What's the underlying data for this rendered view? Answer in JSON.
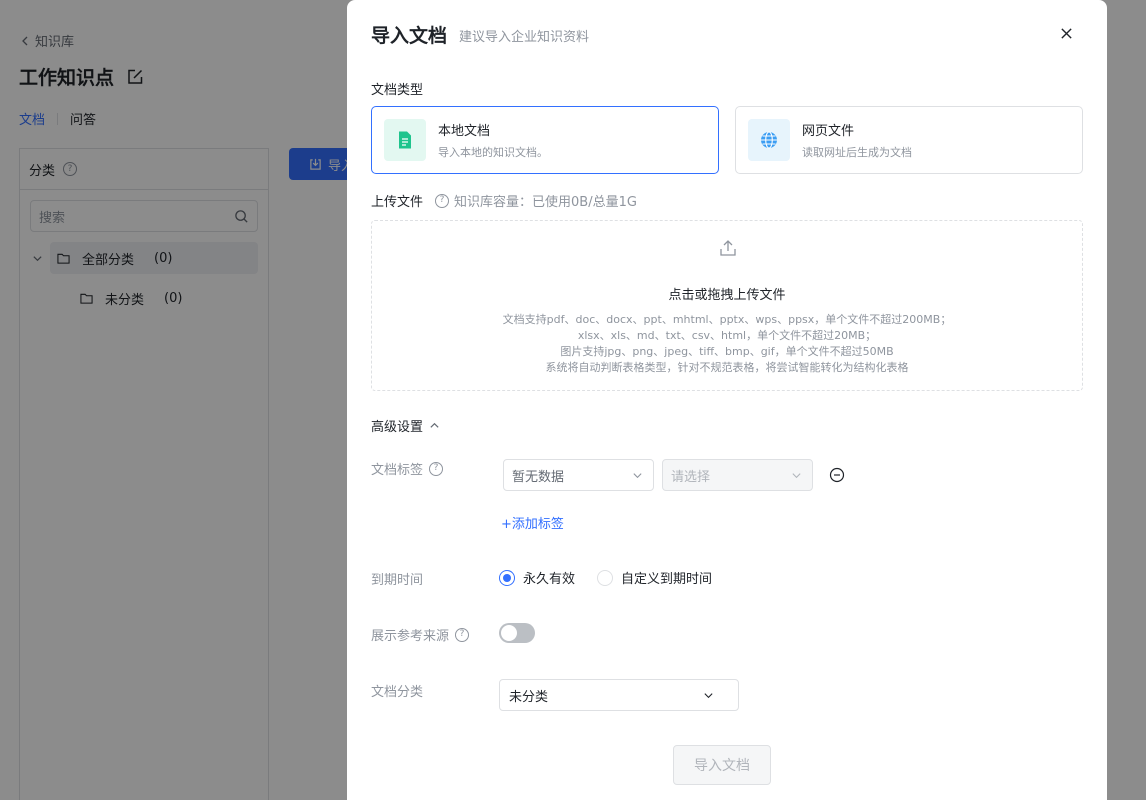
{
  "background": {
    "back_label": "知识库",
    "page_title": "工作知识点",
    "tabs": [
      {
        "label": "文档",
        "active": true
      },
      {
        "label": "问答",
        "active": false
      }
    ],
    "category_panel": {
      "title": "分类",
      "search_placeholder": "搜索",
      "tree": [
        {
          "label": "全部分类",
          "count": "(0)",
          "expanded": true,
          "selected": true
        },
        {
          "label": "未分类",
          "count": "(0)"
        }
      ]
    },
    "import_button_label": "导入"
  },
  "modal": {
    "title": "导入文档",
    "subtitle": "建议导入企业知识资料",
    "doc_type_label": "文档类型",
    "doc_types": [
      {
        "title": "本地文档",
        "desc": "导入本地的知识文档。",
        "icon": "file-icon",
        "selected": true
      },
      {
        "title": "网页文件",
        "desc": "读取网址后生成为文档",
        "icon": "globe-icon",
        "selected": false
      }
    ],
    "upload": {
      "label": "上传文件",
      "capacity_text": "知识库容量：已使用0B/总量1G",
      "title": "点击或拖拽上传文件",
      "lines": [
        "文档支持pdf、doc、docx、ppt、mhtml、pptx、wps、ppsx，单个文件不超过200MB；",
        "xlsx、xls、md、txt、csv、html，单个文件不超过20MB；",
        "图片支持jpg、png、jpeg、tiff、bmp、gif，单个文件不超过50MB",
        "系统将自动判断表格类型，针对不规范表格，将尝试智能转化为结构化表格"
      ]
    },
    "advanced_label": "高级设置",
    "tags": {
      "label": "文档标签",
      "select1_value": "暂无数据",
      "select2_placeholder": "请选择",
      "add_label": "+添加标签"
    },
    "expire": {
      "label": "到期时间",
      "options": [
        {
          "label": "永久有效",
          "selected": true
        },
        {
          "label": "自定义到期时间",
          "selected": false
        }
      ]
    },
    "show_source": {
      "label": "展示参考来源",
      "enabled": false
    },
    "category": {
      "label": "文档分类",
      "value": "未分类"
    },
    "submit_label": "导入文档"
  },
  "colors": {
    "accent": "#3370ff",
    "overlay": "rgba(0,0,0,0.45)"
  }
}
